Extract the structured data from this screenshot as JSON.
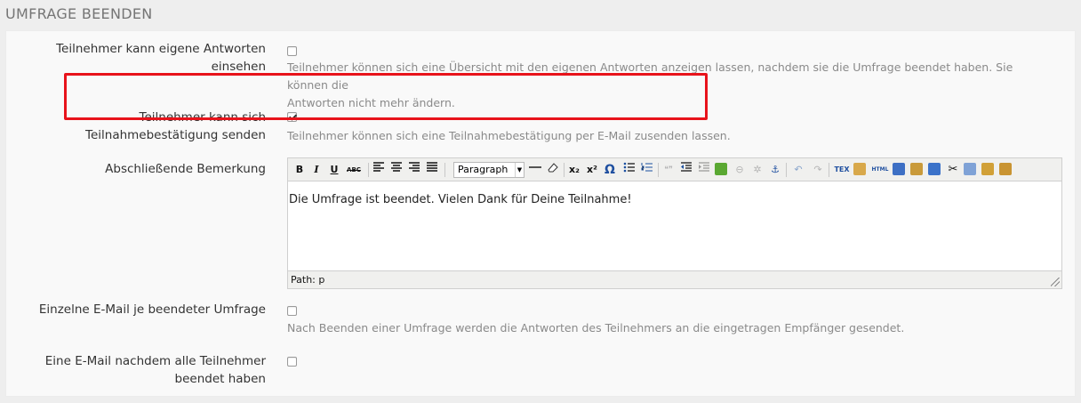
{
  "section": {
    "title": "UMFRAGE BEENDEN"
  },
  "settings": {
    "own_answers": {
      "label_line1": "Teilnehmer kann eigene Antworten",
      "label_line2": "einsehen",
      "checked": false,
      "help_line1": "Teilnehmer können sich eine Übersicht mit den eigenen Antworten anzeigen lassen, nachdem sie die Umfrage beendet haben. Sie können die",
      "help_line2": "Antworten nicht mehr ändern."
    },
    "confirmation": {
      "label_line1": "Teilnehmer kann sich",
      "label_line2": "Teilnahmebestätigung senden",
      "checked": true,
      "help": "Teilnehmer können sich eine Teilnahmebestätigung per E-Mail zusenden lassen."
    },
    "closing_remark": {
      "label": "Abschließende Bemerkung",
      "format_select": "Paragraph",
      "content": "Die Umfrage ist beendet. Vielen Dank für Deine Teilnahme!",
      "path": "Path: p"
    },
    "single_email": {
      "label": "Einzelne E-Mail je beendeter Umfrage",
      "checked": false,
      "help": "Nach Beenden einer Umfrage werden die Antworten des Teilnehmers an die eingetragen Empfänger gesendet."
    },
    "all_done_email": {
      "label_line1": "Eine E-Mail nachdem alle Teilnehmer",
      "label_line2": "beendet haben",
      "checked": false
    }
  },
  "toolbar": {
    "bold": "B",
    "italic": "I",
    "underline": "U",
    "strike": "ABC",
    "subscript": "x₂",
    "superscript": "x²",
    "omega": "Ω",
    "tex": "TEX",
    "html": "HTML"
  },
  "colors": {
    "highlight": "#e8131b",
    "help_text": "#8a8a8a",
    "panel_bg": "#f9f9f9"
  }
}
